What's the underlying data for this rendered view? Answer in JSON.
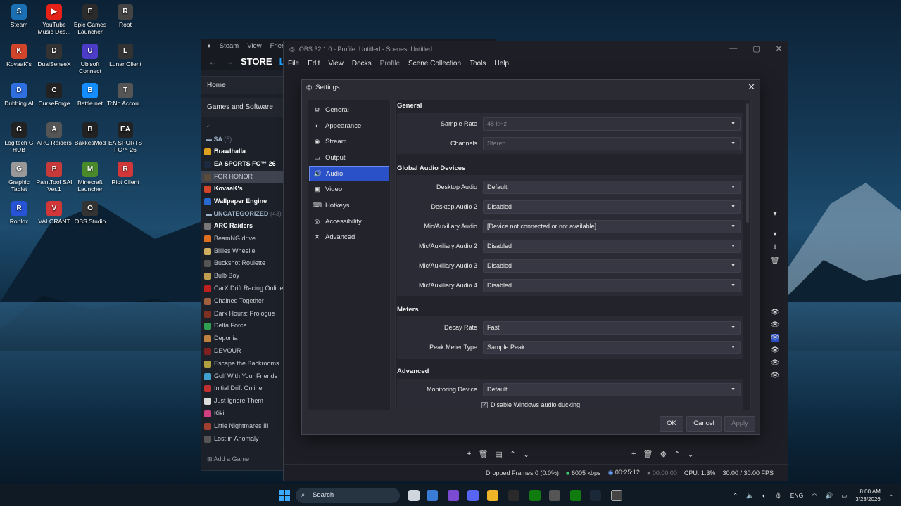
{
  "desktop": {
    "icons": [
      {
        "label": "Steam",
        "color": "#1b6fb3",
        "glyph": "S"
      },
      {
        "label": "YouTube Music Des...",
        "color": "#e62117",
        "glyph": "▶"
      },
      {
        "label": "Epic Games Launcher",
        "color": "#2b2b2b",
        "glyph": "E"
      },
      {
        "label": "Root",
        "color": "#444",
        "glyph": "R"
      },
      {
        "label": "KovaaK's",
        "color": "#d3452b",
        "glyph": "K"
      },
      {
        "label": "DualSenseX",
        "color": "#333",
        "glyph": "D"
      },
      {
        "label": "Ubisoft Connect",
        "color": "#4c3cc8",
        "glyph": "U"
      },
      {
        "label": "Lunar Client",
        "color": "#333",
        "glyph": "L"
      },
      {
        "label": "Dubbing AI",
        "color": "#2f6fe0",
        "glyph": "D"
      },
      {
        "label": "CurseForge",
        "color": "#222",
        "glyph": "C"
      },
      {
        "label": "Battle.net",
        "color": "#148eff",
        "glyph": "B"
      },
      {
        "label": "TcNo Accou...",
        "color": "#555",
        "glyph": "T"
      },
      {
        "label": "Logitech G HUB",
        "color": "#222",
        "glyph": "G"
      },
      {
        "label": "ARC Raiders",
        "color": "#555",
        "glyph": "A"
      },
      {
        "label": "BakkesMod",
        "color": "#222",
        "glyph": "B"
      },
      {
        "label": "EA SPORTS FC™ 26",
        "color": "#222",
        "glyph": "EA"
      },
      {
        "label": "Graphic Tablet",
        "color": "#999",
        "glyph": "G"
      },
      {
        "label": "PaintTool SAI Ver.1",
        "color": "#c83a3a",
        "glyph": "P"
      },
      {
        "label": "Minecraft Launcher",
        "color": "#4a8a2b",
        "glyph": "M"
      },
      {
        "label": "Riot Client",
        "color": "#d13639",
        "glyph": "R"
      },
      {
        "label": "Roblox",
        "color": "#2754d6",
        "glyph": "R"
      },
      {
        "label": "VALORANT",
        "color": "#d13639",
        "glyph": "V"
      },
      {
        "label": "OBS Studio",
        "color": "#333",
        "glyph": "O"
      }
    ]
  },
  "steam": {
    "menu": [
      "Steam",
      "View",
      "Friends"
    ],
    "store": "STORE",
    "home": "Home",
    "games_software": "Games and Software",
    "group1": {
      "name": "SA",
      "count": "(5)"
    },
    "group1_items": [
      {
        "name": "Brawlhalla",
        "color": "#e0a020",
        "bold": true
      },
      {
        "name": "EA SPORTS FC™ 26",
        "color": "#1c2a40",
        "bold": true
      },
      {
        "name": "FOR HONOR",
        "color": "#5a4a3a",
        "bold": false,
        "selected": true
      },
      {
        "name": "KovaaK's",
        "color": "#d3452b",
        "bold": true
      },
      {
        "name": "Wallpaper Engine",
        "color": "#2a6ad0",
        "bold": true
      }
    ],
    "group2": {
      "name": "UNCATEGORIZED",
      "count": "(43)"
    },
    "group2_items": [
      {
        "name": "ARC Raiders",
        "color": "#777",
        "bold": true
      },
      {
        "name": "BeamNG.drive",
        "color": "#e07020"
      },
      {
        "name": "Billies Wheelie",
        "color": "#d0b060"
      },
      {
        "name": "Buckshot Roulette",
        "color": "#555"
      },
      {
        "name": "Bulb Boy",
        "color": "#c0a050"
      },
      {
        "name": "CarX Drift Racing Online",
        "color": "#c02020"
      },
      {
        "name": "Chained Together",
        "color": "#a06040"
      },
      {
        "name": "Dark Hours: Prologue",
        "color": "#803020"
      },
      {
        "name": "Delta Force",
        "color": "#30a050"
      },
      {
        "name": "Deponia",
        "color": "#c08040"
      },
      {
        "name": "DEVOUR",
        "color": "#802020"
      },
      {
        "name": "Escape the Backrooms",
        "color": "#b0a040"
      },
      {
        "name": "Golf With Your Friends",
        "color": "#40a0d0"
      },
      {
        "name": "Initial Drift Online",
        "color": "#c03030"
      },
      {
        "name": "Just Ignore Them",
        "color": "#ddd"
      },
      {
        "name": "Kiki",
        "color": "#d04080"
      },
      {
        "name": "Little Nightmares III",
        "color": "#a04030"
      },
      {
        "name": "Lost in Anomaly",
        "color": "#555"
      }
    ],
    "add_game": "Add a Game"
  },
  "obs": {
    "title": "OBS 32.1.0 - Profile: Untitled - Scenes: Untitled",
    "menu": [
      "File",
      "Edit",
      "View",
      "Docks",
      "Profile",
      "Scene Collection",
      "Tools",
      "Help"
    ],
    "status": {
      "dropped": "Dropped Frames 0 (0.0%)",
      "kbps": "6005 kbps",
      "rec_time": "00:25:12",
      "stream_time": "00:00:00",
      "cpu": "CPU: 1.3%",
      "fps": "30.00 / 30.00 FPS"
    }
  },
  "settings": {
    "title": "Settings",
    "nav": [
      {
        "label": "General",
        "icon": "gear-icon",
        "glyph": "⚙"
      },
      {
        "label": "Appearance",
        "icon": "palette-icon",
        "glyph": "◐"
      },
      {
        "label": "Stream",
        "icon": "broadcast-icon",
        "glyph": "◉"
      },
      {
        "label": "Output",
        "icon": "output-icon",
        "glyph": "▭"
      },
      {
        "label": "Audio",
        "icon": "speaker-icon",
        "glyph": "🔊",
        "active": true
      },
      {
        "label": "Video",
        "icon": "monitor-icon",
        "glyph": "▣"
      },
      {
        "label": "Hotkeys",
        "icon": "keyboard-icon",
        "glyph": "⌨"
      },
      {
        "label": "Accessibility",
        "icon": "accessibility-icon",
        "glyph": "◎"
      },
      {
        "label": "Advanced",
        "icon": "wrench-icon",
        "glyph": "✕"
      }
    ],
    "general_header": "General",
    "sample_rate": {
      "label": "Sample Rate",
      "value": "48 kHz"
    },
    "channels": {
      "label": "Channels",
      "value": "Stereo"
    },
    "devices_header": "Global Audio Devices",
    "devices": [
      {
        "label": "Desktop Audio",
        "value": "Default"
      },
      {
        "label": "Desktop Audio 2",
        "value": "Disabled"
      },
      {
        "label": "Mic/Auxiliary Audio",
        "value": "[Device not connected or not available]"
      },
      {
        "label": "Mic/Auxiliary Audio 2",
        "value": "Disabled"
      },
      {
        "label": "Mic/Auxiliary Audio 3",
        "value": "Disabled"
      },
      {
        "label": "Mic/Auxiliary Audio 4",
        "value": "Disabled"
      }
    ],
    "meters_header": "Meters",
    "decay_rate": {
      "label": "Decay Rate",
      "value": "Fast"
    },
    "peak_meter": {
      "label": "Peak Meter Type",
      "value": "Sample Peak"
    },
    "advanced_header": "Advanced",
    "monitoring": {
      "label": "Monitoring Device",
      "value": "Default"
    },
    "ducking_label": "Disable Windows audio ducking",
    "ducking_checked": true,
    "buttons": {
      "ok": "OK",
      "cancel": "Cancel",
      "apply": "Apply"
    }
  },
  "taskbar": {
    "search": "Search",
    "lang": "ENG",
    "time": "8:00 AM",
    "date": "3/23/2026"
  }
}
